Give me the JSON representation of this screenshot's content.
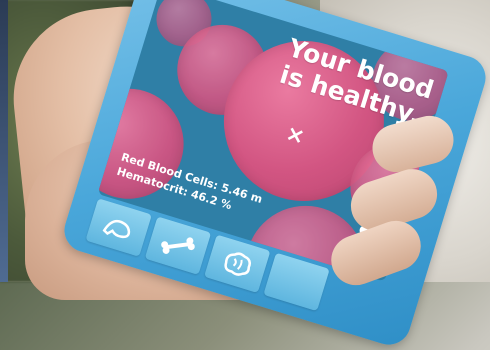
{
  "screen": {
    "headline": "Your blood is healthy.",
    "close_glyph": "×",
    "stats": [
      {
        "label": "Red Blood Cells:",
        "value": "5.46 m"
      },
      {
        "label": "Hematocrit:",
        "value": "46.2 %"
      }
    ],
    "toolbar_icons": [
      "muscle-arm-icon",
      "bone-icon",
      "brain-icon"
    ]
  },
  "colors": {
    "phone_blue": "#4aa7da",
    "screen_teal": "#2f7fa6",
    "cell_pink": "#d25582",
    "text_white": "#ffffff"
  }
}
